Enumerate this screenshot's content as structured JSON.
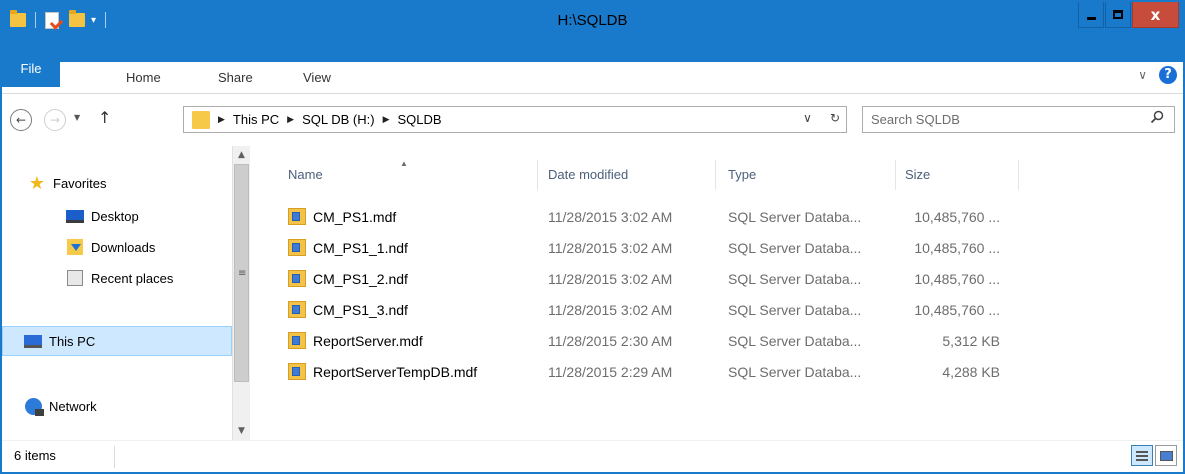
{
  "window": {
    "title": "H:\\SQLDB",
    "close_label": "x"
  },
  "ribbon": {
    "tabs": [
      {
        "label": "File"
      },
      {
        "label": "Home"
      },
      {
        "label": "Share"
      },
      {
        "label": "View"
      }
    ],
    "help_label": "?"
  },
  "address": {
    "breadcrumbs": [
      "This PC",
      "SQL DB (H:)",
      "SQLDB"
    ]
  },
  "search": {
    "placeholder": "Search SQLDB"
  },
  "navigation": {
    "favorites": "Favorites",
    "desktop": "Desktop",
    "downloads": "Downloads",
    "recent_places": "Recent places",
    "this_pc": "This PC",
    "network": "Network"
  },
  "file_list": {
    "columns": [
      "Name",
      "Date modified",
      "Type",
      "Size"
    ],
    "rows": [
      {
        "name": "CM_PS1.mdf",
        "date": "11/28/2015 3:02 AM",
        "type": "SQL Server Databa...",
        "size": "10,485,760 ..."
      },
      {
        "name": "CM_PS1_1.ndf",
        "date": "11/28/2015 3:02 AM",
        "type": "SQL Server Databa...",
        "size": "10,485,760 ..."
      },
      {
        "name": "CM_PS1_2.ndf",
        "date": "11/28/2015 3:02 AM",
        "type": "SQL Server Databa...",
        "size": "10,485,760 ..."
      },
      {
        "name": "CM_PS1_3.ndf",
        "date": "11/28/2015 3:02 AM",
        "type": "SQL Server Databa...",
        "size": "10,485,760 ..."
      },
      {
        "name": "ReportServer.mdf",
        "date": "11/28/2015 2:30 AM",
        "type": "SQL Server Databa...",
        "size": "5,312 KB"
      },
      {
        "name": "ReportServerTempDB.mdf",
        "date": "11/28/2015 2:29 AM",
        "type": "SQL Server Databa...",
        "size": "4,288 KB"
      }
    ]
  },
  "status": {
    "item_count": "6 items"
  },
  "colors": {
    "accent": "#1979ca",
    "selection": "#cde8ff",
    "close_button": "#c74c3c"
  }
}
